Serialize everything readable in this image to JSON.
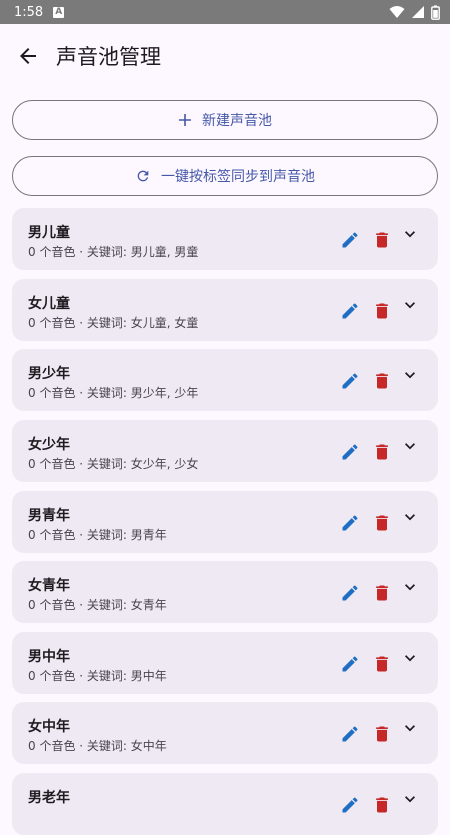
{
  "status_bar": {
    "time": "1:58",
    "notification_icon": "a-icon"
  },
  "app_bar": {
    "title": "声音池管理",
    "back_icon": "arrow-back-icon"
  },
  "actions": {
    "new_pool_label": "新建声音池",
    "sync_label": "一键按标签同步到声音池"
  },
  "colors": {
    "accent": "#4659a9",
    "edit": "#1e6fc4",
    "delete": "#c62828",
    "card_bg": "#efe9f3",
    "page_bg": "#fdf7ff"
  },
  "pools": [
    {
      "name": "男儿童",
      "summary": "0 个音色 · 关键词: 男儿童, 男童"
    },
    {
      "name": "女儿童",
      "summary": "0 个音色 · 关键词: 女儿童, 女童"
    },
    {
      "name": "男少年",
      "summary": "0 个音色 · 关键词: 男少年, 少年"
    },
    {
      "name": "女少年",
      "summary": "0 个音色 · 关键词: 女少年, 少女"
    },
    {
      "name": "男青年",
      "summary": "0 个音色 · 关键词: 男青年"
    },
    {
      "name": "女青年",
      "summary": "0 个音色 · 关键词: 女青年"
    },
    {
      "name": "男中年",
      "summary": "0 个音色 · 关键词: 男中年"
    },
    {
      "name": "女中年",
      "summary": "0 个音色 · 关键词: 女中年"
    },
    {
      "name": "男老年",
      "summary": ""
    }
  ]
}
